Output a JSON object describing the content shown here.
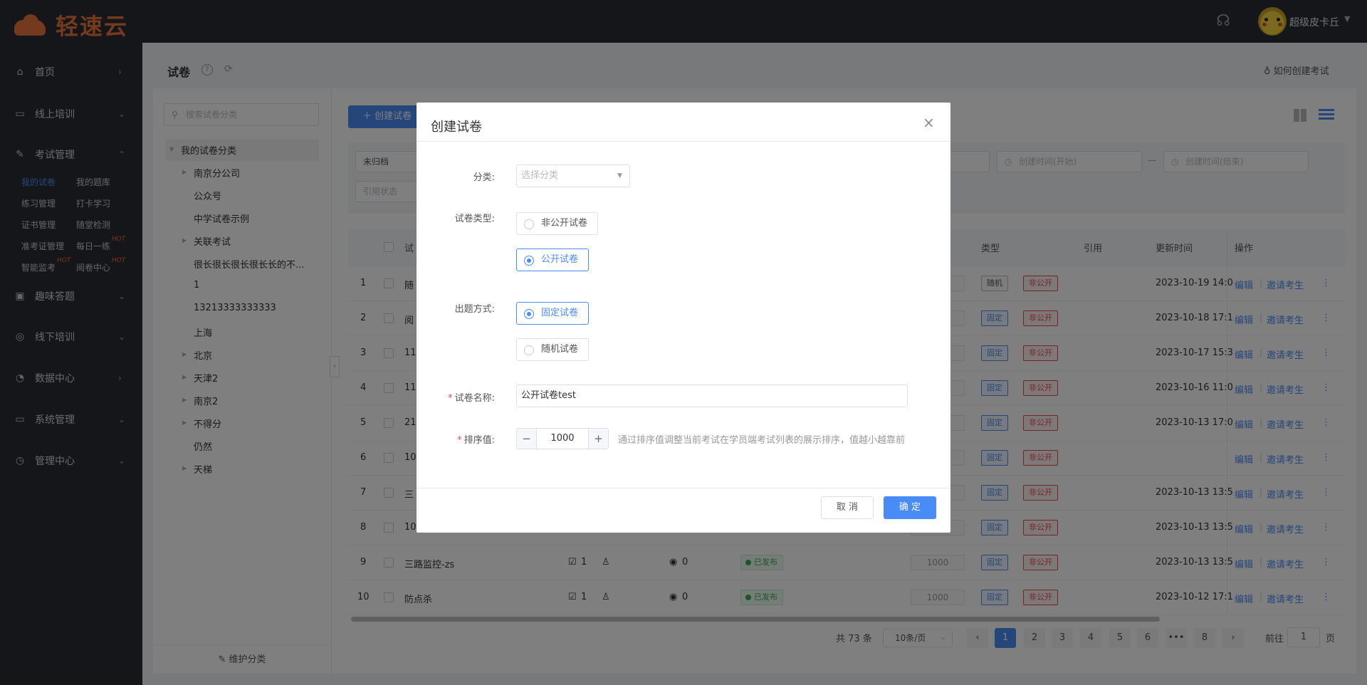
{
  "app": {
    "logo_text": "轻速云",
    "user_name": "超级皮卡丘"
  },
  "sidebar": {
    "items": [
      {
        "label": "首页"
      },
      {
        "label": "线上培训"
      },
      {
        "label": "考试管理"
      },
      {
        "label": "趣味答题"
      },
      {
        "label": "线下培训"
      },
      {
        "label": "数据中心"
      },
      {
        "label": "系统管理"
      },
      {
        "label": "管理中心"
      }
    ],
    "exam_sub": [
      {
        "label": "我的试卷",
        "active": true
      },
      {
        "label": "我的题库"
      },
      {
        "label": "练习管理"
      },
      {
        "label": "打卡学习"
      },
      {
        "label": "证书管理"
      },
      {
        "label": "随堂检测"
      },
      {
        "label": "准考证管理"
      },
      {
        "label": "每日一练",
        "badge": "HOT"
      },
      {
        "label": "智能监考",
        "badge": "HOT"
      },
      {
        "label": "阅卷中心",
        "badge": "HOT"
      }
    ]
  },
  "header": {
    "title": "试卷",
    "howto": "如何创建考试"
  },
  "tree": {
    "search_placeholder": "搜索试卷分类",
    "root": "我的试卷分类",
    "nodes": [
      "南京分公司",
      "公众号",
      "中学试卷示例",
      "关联考试",
      "很长很长很长很长长的不...",
      "1",
      "13213333333333",
      "上海",
      "北京",
      "天津2",
      "南京2",
      "不得分",
      "仍然",
      "天梯"
    ],
    "footer": "维护分类"
  },
  "toolbar": {
    "create_label": "创建试卷"
  },
  "filters": {
    "archive": "未归档",
    "quote": "引用状态",
    "start": "创建时间(开始)",
    "end": "创建时间(结束)",
    "range_sep": "—"
  },
  "table": {
    "headers": {
      "title": "试",
      "type": "类型",
      "quote": "引用",
      "updated": "更新时间",
      "ops": "操作"
    },
    "edit": "编辑",
    "invite": "邀请考生",
    "rows": [
      {
        "no": "1",
        "title": "随",
        "type": "随机",
        "pub": "非公开",
        "updated": "2023-10-19 14:0"
      },
      {
        "no": "2",
        "title": "阅",
        "type": "固定",
        "pub": "非公开",
        "updated": "2023-10-18 17:1"
      },
      {
        "no": "3",
        "title": "11",
        "type": "固定",
        "pub": "非公开",
        "updated": "2023-10-17 15:3"
      },
      {
        "no": "4",
        "title": "11",
        "type": "固定",
        "pub": "非公开",
        "updated": "2023-10-16 11:0"
      },
      {
        "no": "5",
        "title": "21",
        "type": "固定",
        "pub": "非公开",
        "updated": "2023-10-13 17:0"
      },
      {
        "no": "6",
        "title": "10",
        "type": "固定",
        "pub": "非公开",
        "updated": ""
      },
      {
        "no": "7",
        "title": "三",
        "type": "固定",
        "pub": "非公开",
        "updated": "2023-10-13 13:5"
      },
      {
        "no": "8",
        "title": "10",
        "type": "固定",
        "pub": "非公开",
        "updated": "2023-10-13 13:5"
      },
      {
        "no": "9",
        "title": "三路监控-zs",
        "q": "1",
        "loc": "0",
        "status": "已发布",
        "sort": "1000",
        "type": "固定",
        "pub": "非公开",
        "updated": "2023-10-13 13:5"
      },
      {
        "no": "10",
        "title": "防点杀",
        "q": "1",
        "loc": "0",
        "status": "已发布",
        "sort": "1000",
        "type": "固定",
        "pub": "非公开",
        "updated": "2023-10-12 17:1"
      }
    ]
  },
  "pagination": {
    "total": "共 73 条",
    "size": "10条/页",
    "pages": [
      "1",
      "2",
      "3",
      "4",
      "5",
      "6",
      "•••",
      "8"
    ],
    "goto": "前往",
    "goto_value": "1",
    "page_suffix": "页"
  },
  "dialog": {
    "title": "创建试卷",
    "category_label": "分类:",
    "category_placeholder": "选择分类",
    "paper_type_label": "试卷类型:",
    "paper_type_options": [
      "非公开试卷",
      "公开试卷"
    ],
    "mode_label": "出题方式:",
    "mode_options": [
      "固定试卷",
      "随机试卷"
    ],
    "name_label": "试卷名称:",
    "name_value": "公开试卷test",
    "sort_label": "排序值:",
    "sort_value": "1000",
    "sort_hint": "通过排序值调整当前考试在学员端考试列表的展示排序，值越小越靠前",
    "cancel": "取 消",
    "ok": "确 定"
  }
}
